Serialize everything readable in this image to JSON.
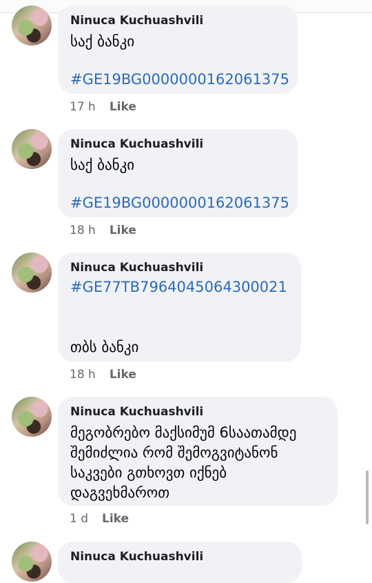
{
  "comments": [
    {
      "author": "Ninuca Kuchuashvili",
      "lines": [
        "საქ ბანკი",
        "",
        "#GE19BG0000000162061375"
      ],
      "time": "17 h",
      "like": "Like"
    },
    {
      "author": "Ninuca Kuchuashvili",
      "lines": [
        "საქ ბანკი",
        "",
        "#GE19BG0000000162061375"
      ],
      "time": "18 h",
      "like": "Like"
    },
    {
      "author": "Ninuca Kuchuashvili",
      "lines": [
        "#GE77TB7964045064300021",
        "",
        "",
        "თბს ბანკი"
      ],
      "time": "18 h",
      "like": "Like"
    },
    {
      "author": "Ninuca Kuchuashvili",
      "lines": [
        "მეგობრებო მაქსიმუმ 6საათამდე",
        "შემიძლია რომ შემოგვიტანონ",
        "საკვები გთხოვთ იქნებ",
        "დაგვეხმაროთ"
      ],
      "time": "1 d",
      "like": "Like"
    },
    {
      "author": "Ninuca Kuchuashvili",
      "lines": [],
      "time": "",
      "like": ""
    }
  ],
  "colors": {
    "bubble": "#f0f2f5",
    "hashtag": "#2d6ab6",
    "meta": "#65676b"
  }
}
